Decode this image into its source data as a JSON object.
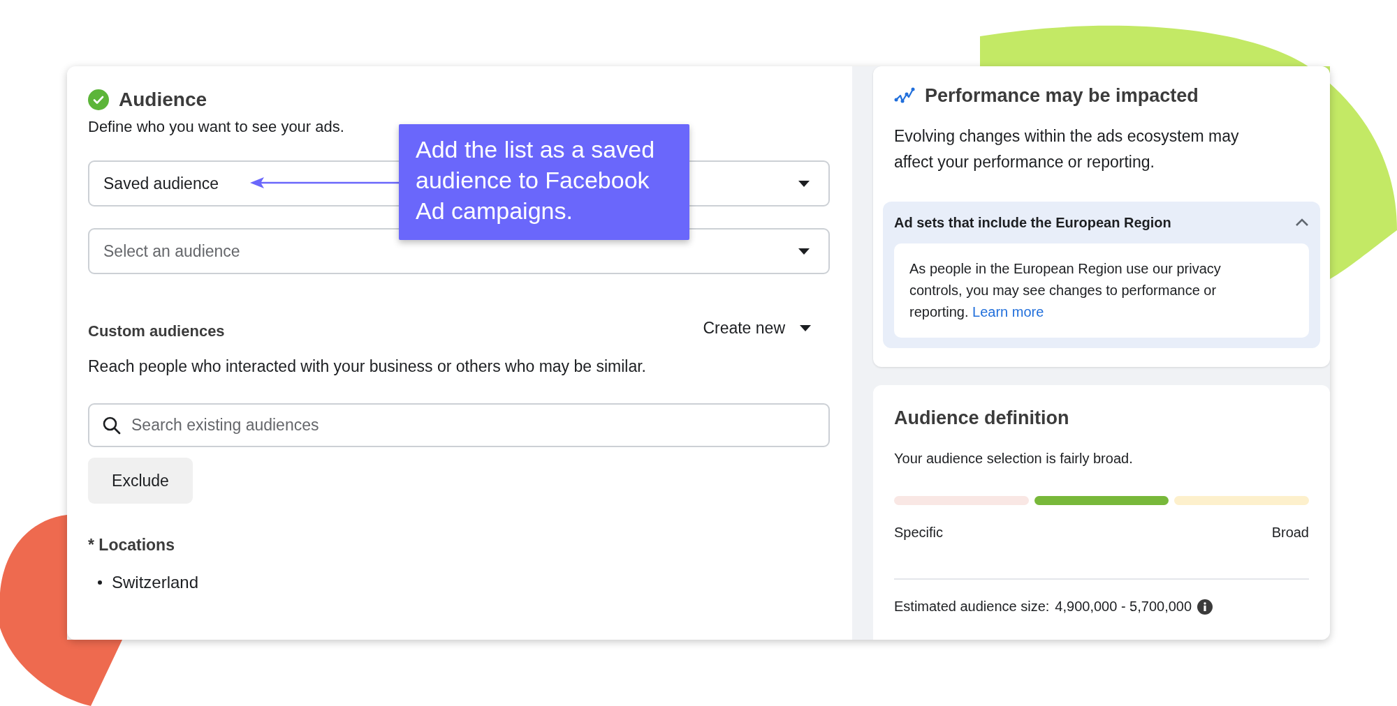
{
  "audience_section": {
    "title": "Audience",
    "complete": true,
    "subtitle": "Define who you want to see your ads.",
    "audience_type_dropdown": {
      "value": "Saved audience"
    },
    "audience_dropdown": {
      "placeholder": "Select an audience"
    },
    "custom_audiences": {
      "title": "Custom audiences",
      "create_button": "Create new",
      "description": "Reach people who interacted with your business or others who may be similar.",
      "search": {
        "placeholder": "Search existing audiences"
      },
      "exclude_button": "Exclude"
    },
    "locations": {
      "title": "* Locations",
      "items": [
        "Switzerland"
      ]
    }
  },
  "callout": {
    "text": "Add the list as a saved audience to Facebook Ad campaigns."
  },
  "performance_card": {
    "title": "Performance may be impacted",
    "body": "Evolving changes within the ads ecosystem may affect your performance or reporting.",
    "accordion": {
      "title": "Ad sets that include the European Region",
      "expanded": true,
      "body": "As people in the European Region use our privacy controls, you may see changes to performance or reporting.",
      "link": "Learn more"
    }
  },
  "audience_definition": {
    "title": "Audience definition",
    "summary": "Your audience selection is fairly broad.",
    "meter": {
      "segments": [
        {
          "selected": false
        },
        {
          "selected": true
        },
        {
          "selected": false
        }
      ],
      "min_label": "Specific",
      "max_label": "Broad"
    },
    "estimate": {
      "label": "Estimated audience size:",
      "value": "4,900,000 - 5,700,000"
    }
  }
}
